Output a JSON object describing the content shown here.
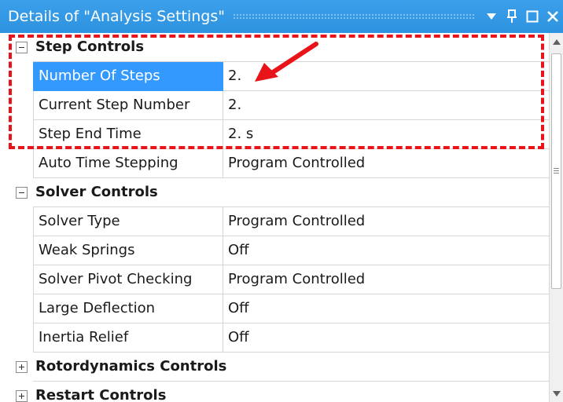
{
  "window": {
    "title": "Details of \"Analysis Settings\""
  },
  "grid": {
    "categories": [
      {
        "label": "Step Controls",
        "expanded": true,
        "properties": [
          {
            "name": "Number Of Steps",
            "value": "2.",
            "selected": true
          },
          {
            "name": "Current Step Number",
            "value": "2."
          },
          {
            "name": "Step End Time",
            "value": "2. s"
          },
          {
            "name": "Auto Time Stepping",
            "value": "Program Controlled"
          }
        ]
      },
      {
        "label": "Solver Controls",
        "expanded": true,
        "properties": [
          {
            "name": "Solver Type",
            "value": "Program Controlled"
          },
          {
            "name": "Weak Springs",
            "value": "Off"
          },
          {
            "name": "Solver Pivot Checking",
            "value": "Program Controlled"
          },
          {
            "name": "Large Deflection",
            "value": "Off"
          },
          {
            "name": "Inertia Relief",
            "value": "Off"
          }
        ]
      },
      {
        "label": "Rotordynamics Controls",
        "expanded": false,
        "properties": []
      },
      {
        "label": "Restart Controls",
        "expanded": false,
        "properties": []
      }
    ]
  },
  "icons": {
    "dropdown": "dropdown-arrow-icon",
    "pin": "pin-icon",
    "maximize": "maximize-icon",
    "close": "close-icon",
    "expander_collapse": "minus-box-icon",
    "expander_expand": "plus-box-icon"
  },
  "colors": {
    "titlebar": "#3399e6",
    "selection": "#3399ff",
    "highlight": "#e8141a",
    "gridline": "#d6d6d6"
  }
}
